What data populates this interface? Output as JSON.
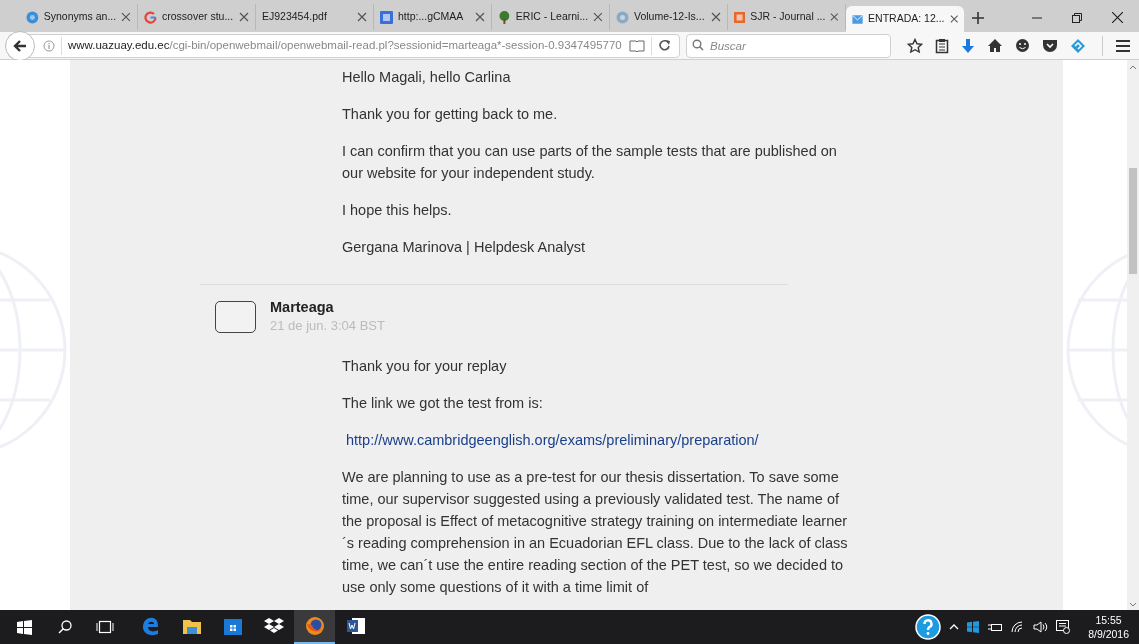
{
  "tabs": [
    {
      "label": "Synonyms an...",
      "selected": false
    },
    {
      "label": "crossover stu...",
      "selected": false
    },
    {
      "label": "EJ923454.pdf",
      "selected": false
    },
    {
      "label": "http:...gCMAA",
      "selected": false
    },
    {
      "label": "ERIC - Learni...",
      "selected": false
    },
    {
      "label": "Volume-12-Is...",
      "selected": false
    },
    {
      "label": "SJR - Journal ...",
      "selected": false
    },
    {
      "label": "ENTRADA: 12...",
      "selected": true
    }
  ],
  "address": {
    "url_host": "www.uazuay.edu.ec",
    "url_path": "/cgi-bin/openwebmail/openwebmail-read.pl?sessionid=marteaga*-session-0.9347495770"
  },
  "search": {
    "placeholder": "Buscar"
  },
  "messages": [
    {
      "paragraphs": [
        "Hello Magali, hello Carlina",
        "Thank you for getting back to me.",
        "I can confirm that you can use parts of the sample tests that are published on our website for your independent study.",
        "I hope this helps.",
        "Gergana Marinova | Helpdesk Analyst"
      ]
    },
    {
      "sender": "Marteaga",
      "date": "21 de jun. 3:04 BST",
      "paragraphs": [
        "Thank you for your replay",
        "The link we got the test from is:"
      ],
      "link": "http://www.cambridgeenglish.org/exams/preliminary/preparation/",
      "paragraphs_after": [
        "We are planning to use as a pre-test for our thesis dissertation. To save some time, our supervisor suggested using a previously validated test. The name of the proposal is Effect of metacognitive strategy training on intermediate learner´s reading comprehension in an Ecuadorian EFL class. Due to the lack of class time, we can´t use the entire reading section of the PET test, so we decided to use only some questions of it with a time limit of"
      ]
    }
  ],
  "taskbar": {
    "apps": [
      {
        "kind": "edge",
        "active": false
      },
      {
        "kind": "explorer",
        "active": false
      },
      {
        "kind": "store",
        "active": false
      },
      {
        "kind": "dropbox",
        "active": false
      },
      {
        "kind": "firefox",
        "active": true
      },
      {
        "kind": "word",
        "active": false
      }
    ],
    "time": "15:55",
    "date": "8/9/2016"
  }
}
